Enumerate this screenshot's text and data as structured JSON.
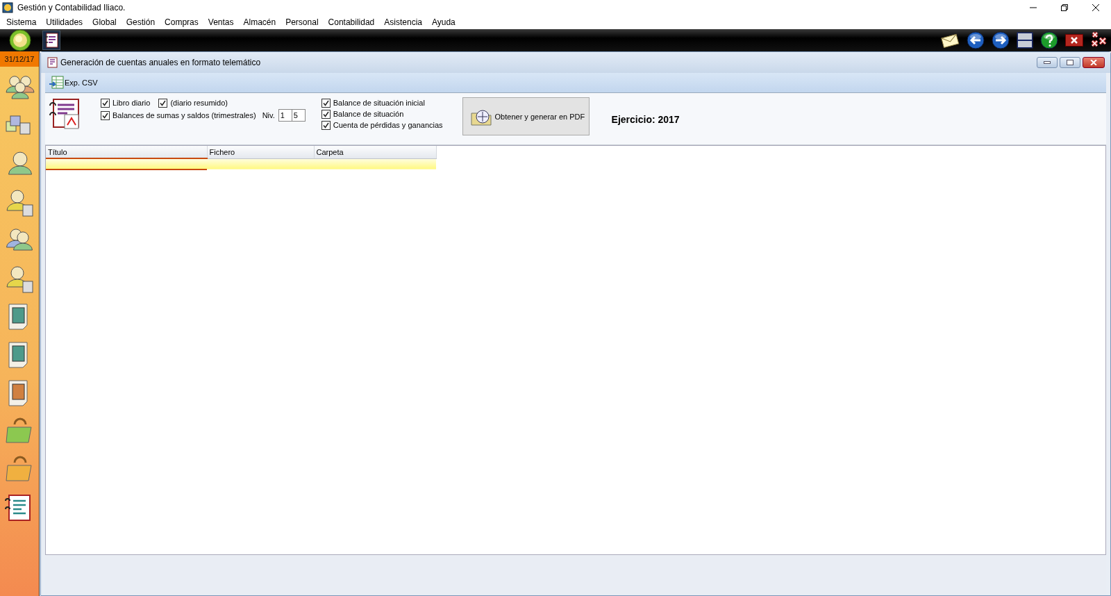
{
  "window": {
    "title": "Gestión y Contabilidad Iliaco."
  },
  "menu": [
    "Sistema",
    "Utilidades",
    "Global",
    "Gestión",
    "Compras",
    "Ventas",
    "Almacén",
    "Personal",
    "Contabilidad",
    "Asistencia",
    "Ayuda"
  ],
  "sidebar": {
    "date": "31/12/17"
  },
  "child_window": {
    "title": "Generación de cuentas anuales en formato telemático",
    "toolbar": [
      {
        "label": "Exp. CSV"
      }
    ],
    "journal_options": [
      {
        "label": "Libro diario",
        "checked": true
      },
      {
        "label": "(diario resumido)",
        "checked": true
      }
    ],
    "sums_option": {
      "label": "Balances de sumas y saldos (trimestrales)",
      "checked": true
    },
    "level_fields": {
      "label": "Niv.",
      "values": [
        "1",
        "5"
      ]
    },
    "balance_options": [
      {
        "label": "Balance de situación inicial",
        "checked": true
      },
      {
        "label": "Balance de situación",
        "checked": true
      },
      {
        "label": "Cuenta de pérdidas y ganancias",
        "checked": true
      }
    ],
    "generate_button": "Obtener y generar en PDF",
    "fiscal_year": "Ejercicio: 2017",
    "table": {
      "columns": [
        "Título",
        "Fichero",
        "Carpeta"
      ],
      "rows": [
        {
          "selected": true
        }
      ]
    }
  }
}
